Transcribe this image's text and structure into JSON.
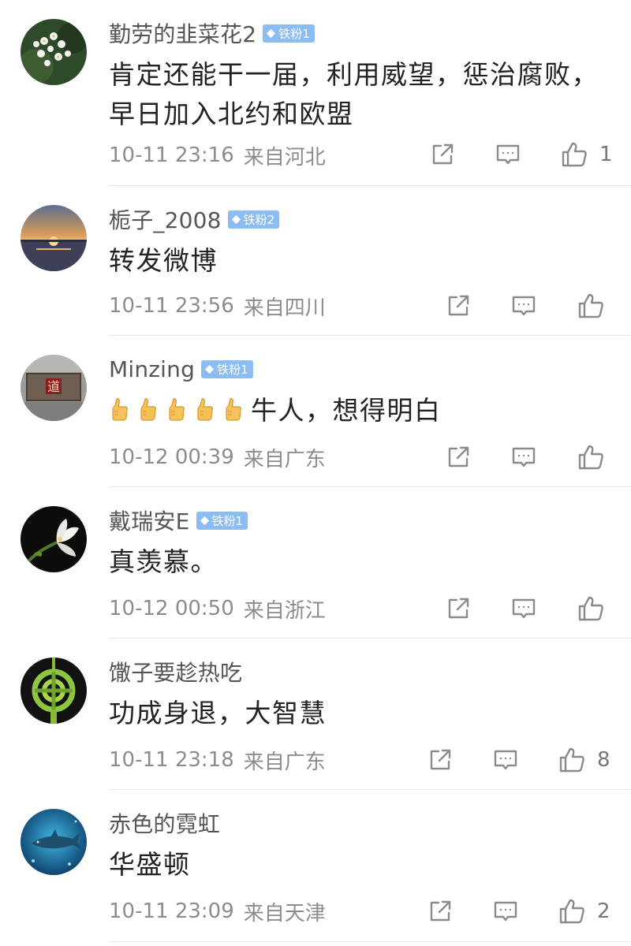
{
  "comments": [
    {
      "avatar_icon": "white-flowers-avatar",
      "username": "勤劳的韭菜花2",
      "badge": "铁粉1",
      "content": "肯定还能干一届，利用威望，惩治腐败，早日加入北约和欧盟",
      "timestamp": "10-11 23:16",
      "location": "来自河北",
      "likes": "1"
    },
    {
      "avatar_icon": "sunset-sea-avatar",
      "username": "栀子_2008",
      "badge": "铁粉2",
      "content": "转发微博",
      "timestamp": "10-11 23:56",
      "location": "来自四川",
      "likes": ""
    },
    {
      "avatar_icon": "calligraphy-plaque-avatar",
      "username": "Minzing",
      "badge": "铁粉1",
      "emoji_count": 5,
      "emoji_icon": "thumbs-up-emoji",
      "content": "牛人，想得明白",
      "timestamp": "10-12 00:39",
      "location": "来自广东",
      "likes": ""
    },
    {
      "avatar_icon": "white-orchid-avatar",
      "username": "戴瑞安E",
      "badge": "铁粉1",
      "content": "真羡慕。",
      "timestamp": "10-12 00:50",
      "location": "来自浙江",
      "likes": ""
    },
    {
      "avatar_icon": "jade-knot-avatar",
      "username": "馓子要趁热吃",
      "badge": "",
      "content": "功成身退，大智慧",
      "timestamp": "10-11 23:18",
      "location": "来自广东",
      "likes": "8"
    },
    {
      "avatar_icon": "shark-underwater-avatar",
      "username": "赤色的霓虹",
      "badge": "",
      "content": "华盛顿",
      "timestamp": "10-11 23:09",
      "location": "来自天津",
      "likes": "2"
    }
  ],
  "icons": {
    "share": "share-icon",
    "comment": "comment-icon",
    "like": "thumbs-up-icon",
    "badge": "diamond-icon"
  },
  "colors": {
    "badge_bg": "#8cbdf2",
    "meta_text": "#8c8c8c",
    "content_text": "#222222",
    "username_text": "#555555",
    "divider": "#e6e6e6"
  }
}
